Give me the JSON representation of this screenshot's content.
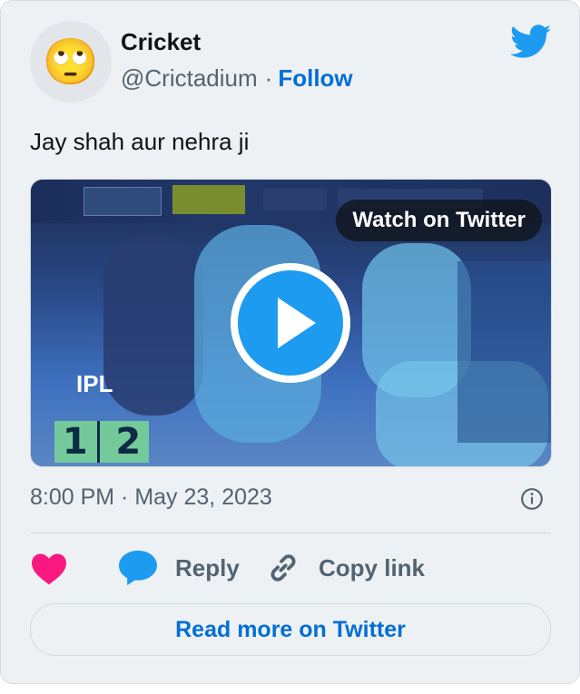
{
  "author": {
    "avatar_emoji": "🙄",
    "name": "Cricket",
    "handle": "@Crictadium",
    "separator": "·",
    "follow_label": "Follow"
  },
  "tweet": {
    "text": "Jay shah aur nehra ji"
  },
  "media": {
    "watch_label": "Watch on Twitter",
    "overlay_text": "IPL",
    "score_left": "1",
    "score_right": "2"
  },
  "meta": {
    "timestamp": "8:00 PM · May 23, 2023"
  },
  "actions": {
    "reply_label": "Reply",
    "copy_label": "Copy link"
  },
  "footer": {
    "read_more_label": "Read more on Twitter"
  },
  "colors": {
    "accent": "#006fd6",
    "twitter_blue": "#1d9bf0",
    "heart": "#f91880",
    "muted": "#536471",
    "card_bg": "#eef1f4"
  }
}
